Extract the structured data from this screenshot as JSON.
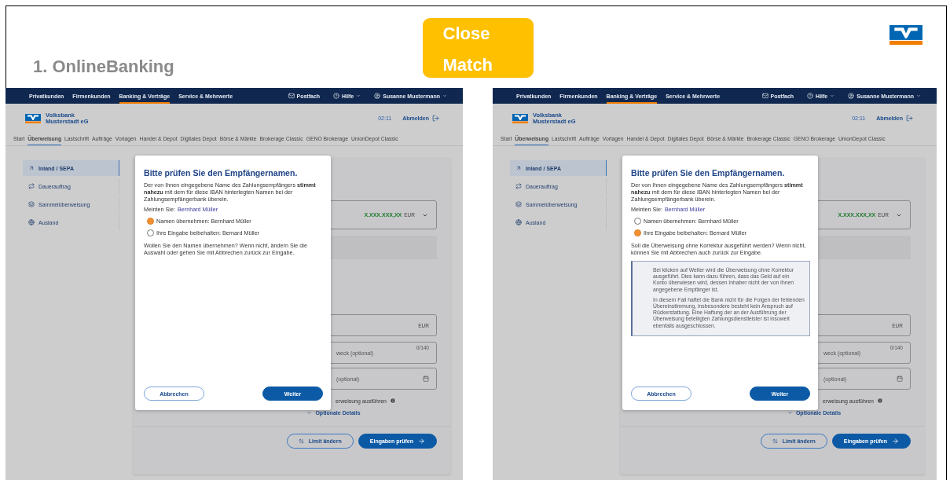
{
  "slide": {
    "title": "1. OnlineBanking",
    "badge": "Close Match"
  },
  "screens": [
    {
      "top_nav": [
        {
          "label": "Privatkunden",
          "selected": false
        },
        {
          "label": "Firmenkunden",
          "selected": false
        },
        {
          "label": "Banking & Verträge",
          "selected": true
        },
        {
          "label": "Service & Mehrwerte",
          "selected": false
        }
      ],
      "mailbox": "Postfach",
      "help": "Hilfe",
      "user": "Susanne Mustermann",
      "bank_name": [
        "Volksbank",
        "Musterstadt eG"
      ],
      "timer": "02:11",
      "logout": "Abmelden",
      "tabs": [
        {
          "label": "Start",
          "selected": false
        },
        {
          "label": "Überweisung",
          "selected": true
        },
        {
          "label": "Lastschrift",
          "selected": false
        },
        {
          "label": "Aufträge",
          "selected": false
        },
        {
          "label": "Vorlagen",
          "selected": false
        },
        {
          "label": "Handel & Depot",
          "selected": false
        },
        {
          "label": "Digitales Depot",
          "selected": false
        },
        {
          "label": "Börse & Märkte",
          "selected": false
        },
        {
          "label": "Brokerage Classic",
          "selected": false
        },
        {
          "label": "GENO Brokerage",
          "selected": false
        },
        {
          "label": "UnionDepot Classic",
          "selected": false
        }
      ],
      "sidebar": [
        {
          "label": "Inland / SEPA",
          "selected": true
        },
        {
          "label": "Dauerauftrag",
          "selected": false
        },
        {
          "label": "Sammelüberweisung",
          "selected": false
        },
        {
          "label": "Ausland",
          "selected": false
        }
      ],
      "form": {
        "balance": "X.XXX.XXX,XX",
        "balance_currency": "EUR",
        "amount_currency": "EUR",
        "purpose": "weck (optional)",
        "counter": "0/140",
        "date": "(optional)",
        "standing_order": "erweisung ausführen",
        "details": "Optionale Details",
        "limit_button": "Limit ändern",
        "submit_button": "Eingaben prüfen"
      },
      "dialog": {
        "title": "Bitte prüfen Sie den Empfängernamen.",
        "text": "Der von Ihnen eingegebene Name des Zahlungsempfängers **stimmt nahezu** mit dem für diese IBAN hinterlegten Namen bei der Zahlungsempfängerbank überein.",
        "suggestion_label": "Meinten Sie:",
        "suggestion": "Bernhard Müller",
        "options": [
          {
            "label": "Namen übernehmen: Bernhard Müller",
            "selected": true
          },
          {
            "label": "Ihre Eingabe beibehalten: Bernard Müller",
            "selected": false
          }
        ],
        "question": "Wollen Sie den Namen übernehmen? Wenn nicht, ändern Sie die Auswahl oder gehen Sie mit Abbrechen zurück zur Eingabe.",
        "cancel": "Abbrechen",
        "next": "Weiter"
      }
    },
    {
      "top_nav": [
        {
          "label": "Privatkunden",
          "selected": false
        },
        {
          "label": "Firmenkunden",
          "selected": false
        },
        {
          "label": "Banking & Verträge",
          "selected": true
        },
        {
          "label": "Service & Mehrwerte",
          "selected": false
        }
      ],
      "mailbox": "Postfach",
      "help": "Hilfe",
      "user": "Susanne Mustermann",
      "bank_name": [
        "Volksbank",
        "Musterstadt eG"
      ],
      "timer": "02:11",
      "logout": "Abmelden",
      "tabs": [
        {
          "label": "Start",
          "selected": false
        },
        {
          "label": "Überweisung",
          "selected": true
        },
        {
          "label": "Lastschrift",
          "selected": false
        },
        {
          "label": "Aufträge",
          "selected": false
        },
        {
          "label": "Vorlagen",
          "selected": false
        },
        {
          "label": "Handel & Depot",
          "selected": false
        },
        {
          "label": "Digitales Depot",
          "selected": false
        },
        {
          "label": "Börse & Märkte",
          "selected": false
        },
        {
          "label": "Brokerage Classic",
          "selected": false
        },
        {
          "label": "GENO Brokerage",
          "selected": false
        },
        {
          "label": "UnionDepot Classic",
          "selected": false
        }
      ],
      "sidebar": [
        {
          "label": "Inland / SEPA",
          "selected": true
        },
        {
          "label": "Dauerauftrag",
          "selected": false
        },
        {
          "label": "Sammelüberweisung",
          "selected": false
        },
        {
          "label": "Ausland",
          "selected": false
        }
      ],
      "form": {
        "balance": "X.XXX.XXX,XX",
        "balance_currency": "EUR",
        "amount_currency": "EUR",
        "purpose": "weck (optional)",
        "counter": "0/140",
        "date": "(optional)",
        "standing_order": "erweisung ausführen",
        "details": "Optionale Details",
        "limit_button": "Limit ändern",
        "submit_button": "Eingaben prüfen"
      },
      "dialog": {
        "title": "Bitte prüfen Sie den Empfängernamen.",
        "text": "Der von Ihnen eingegebene Name des Zahlungsempfängers **stimmt nahezu** mit dem für diese IBAN hinterlegten Namen bei der Zahlungsempfängerbank überein.",
        "suggestion_label": "Meinten Sie:",
        "suggestion": "Bernhard Müller",
        "options": [
          {
            "label": "Namen übernehmen: Bernhard Müller",
            "selected": false
          },
          {
            "label": "Ihre Eingabe beibehalten: Bernard Müller",
            "selected": true
          }
        ],
        "question": "Soll die Überweisung ohne Korrektur ausgeführt werden? Wenn nicht, können Sie mit Abbrechen auch zurück zur Eingabe.",
        "warning": [
          "Bei klicken auf Weiter wird die Überweisung ohne Korrektur ausgeführt. Dies kann dazu führen, dass das Geld auf ein Konto überwiesen wird, dessen Inhaber nicht der von Ihnen angegebene Empfänger ist.",
          "In diesem Fall haftet die Bank nicht für die Folgen der fehlenden Übereinstimmung, insbesondere besteht kein Anspruch auf Rückerstattung. Eine Haftung der an der Ausführung der Überweisung beteiligten Zahlungsdienstleister ist insoweit ebenfalls ausgeschlossen."
        ],
        "cancel": "Abbrechen",
        "next": "Weiter"
      }
    }
  ]
}
